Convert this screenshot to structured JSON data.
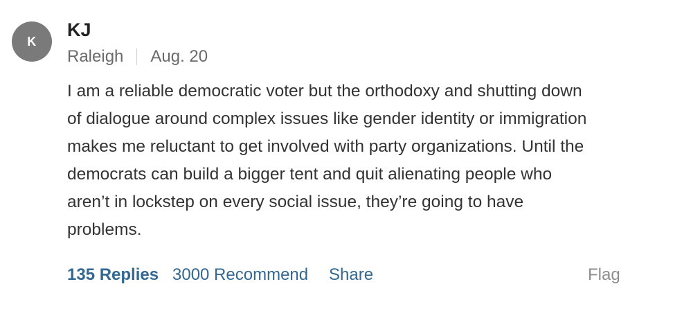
{
  "comment": {
    "avatar_initial": "K",
    "author": "KJ",
    "location": "Raleigh",
    "date": "Aug. 20",
    "lines": [
      "I am a reliable democratic voter but the orthodoxy and shutting down",
      "of dialogue around complex issues like gender identity or immigration",
      "makes me reluctant to get involved with party organizations. Until the",
      "democrats can build a bigger tent and quit alienating people who",
      "aren’t in lockstep on every social issue, they’re going to have",
      "problems."
    ]
  },
  "actions": {
    "replies_label": "135 Replies",
    "recommend_label": "3000 Recommend",
    "share_label": "Share",
    "flag_label": "Flag"
  },
  "colors": {
    "avatar_bg": "#7a7a7a",
    "link": "#326891",
    "muted": "#6a6a6a",
    "flag": "#8e8e8e",
    "text": "#333333"
  }
}
